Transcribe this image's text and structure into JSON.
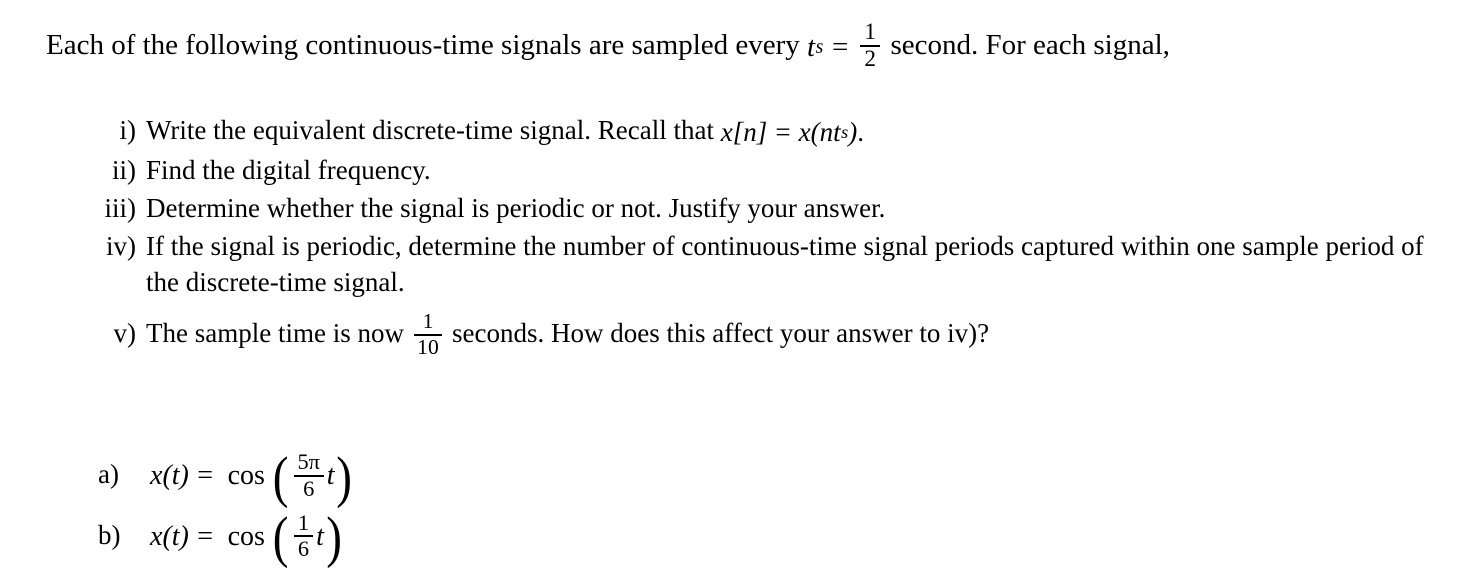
{
  "document": {
    "intro": {
      "before_math": "Each of the following continuous-time signals are sampled every",
      "symbol_t": "t",
      "symbol_t_sub": "s",
      "equals": "=",
      "fraction_numerator": "1",
      "fraction_denominator": "2",
      "after_math": "second. For each signal,"
    },
    "instructions": [
      {
        "marker": "i)",
        "text_before": "Write the equivalent discrete-time signal. Recall that",
        "math": {
          "x1": "x",
          "bracket_open": "[",
          "n1": "n",
          "bracket_close": "]",
          "equals": "=",
          "x2": "x",
          "paren_open": "(",
          "n2": "n",
          "t": "t",
          "t_sub": "s",
          "paren_close": ")",
          "period": "."
        },
        "text_after": ""
      },
      {
        "marker": "ii)",
        "text_before": "Find the digital frequency.",
        "math": null,
        "text_after": ""
      },
      {
        "marker": "iii)",
        "text_before": "Determine whether the signal is periodic or not. Justify your answer.",
        "math": null,
        "text_after": ""
      },
      {
        "marker": "iv)",
        "text_before": "If the signal is periodic, determine the number of continuous-time signal periods captured within one sample period of the discrete-time signal.",
        "math": null,
        "text_after": ""
      },
      {
        "marker": "v)",
        "text_before": "The sample time is now",
        "math": {
          "fraction_numerator": "1",
          "fraction_denominator": "10"
        },
        "text_after": "seconds. How does this affect your answer to iv)?"
      }
    ],
    "signals": [
      {
        "marker": "a)",
        "lhs_function": "x",
        "lhs_paren_open": "(",
        "lhs_variable": "t",
        "lhs_paren_close": ")",
        "equals": "=",
        "operator": "cos",
        "paren_open": "(",
        "fraction_numerator": "5π",
        "fraction_denominator": "6",
        "argument_variable": "t",
        "paren_close": ")"
      },
      {
        "marker": "b)",
        "lhs_function": "x",
        "lhs_paren_open": "(",
        "lhs_variable": "t",
        "lhs_paren_close": ")",
        "equals": "=",
        "operator": "cos",
        "paren_open": "(",
        "fraction_numerator": "1",
        "fraction_denominator": "6",
        "argument_variable": "t",
        "paren_close": ")"
      }
    ]
  },
  "colors": {
    "background": "#ffffff",
    "text": "#000000"
  }
}
